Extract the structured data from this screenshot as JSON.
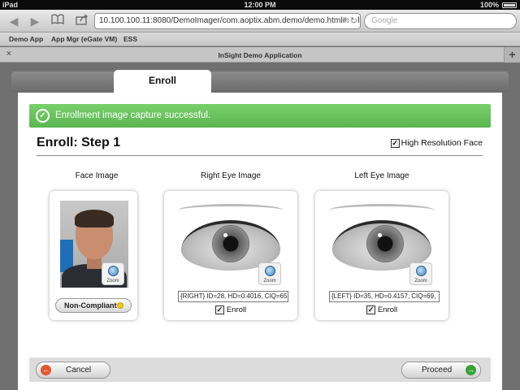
{
  "status_bar": {
    "device": "iPad",
    "time": "12:00 PM",
    "battery": "100%"
  },
  "browser": {
    "url": "10.100.100.11:8080/DemoImager/com.aoptix.abm.demo/demo.html#xml",
    "search_placeholder": "Google",
    "bookmarks": [
      "Demo App",
      "App Mgr (eGate VM)",
      "ESS"
    ],
    "tab_title": "InSight Demo Application",
    "tab_close": "×",
    "tab_add": "+"
  },
  "app_tabs": {
    "active": "Enroll"
  },
  "banner": {
    "text": "Enrollment image capture successful."
  },
  "step": {
    "title": "Enroll: Step 1",
    "high_res_label": "High Resolution Face",
    "high_res_checked": true
  },
  "face": {
    "label": "Face Image",
    "status_button": "Non-Compliant",
    "status_color": "#f2c619",
    "zoom_label": "Zoom"
  },
  "right_eye": {
    "label": "Right Eye Image",
    "info": "{RIGHT} ID=28, HD=0.4016, CIQ=65",
    "enroll_label": "Enroll",
    "enroll_checked": true,
    "zoom_label": "Zoom"
  },
  "left_eye": {
    "label": "Left Eye Image",
    "info": "{LEFT} ID=35, HD=0.4157, CIQ=69,",
    "enroll_label": "Enroll",
    "enroll_checked": true,
    "zoom_label": "Zoom"
  },
  "footer": {
    "cancel_label": "Cancel",
    "proceed_label": "Proceed"
  },
  "colors": {
    "banner": "#5bb651",
    "cancel_icon": "#e2572f",
    "proceed_icon": "#3aa33a"
  }
}
